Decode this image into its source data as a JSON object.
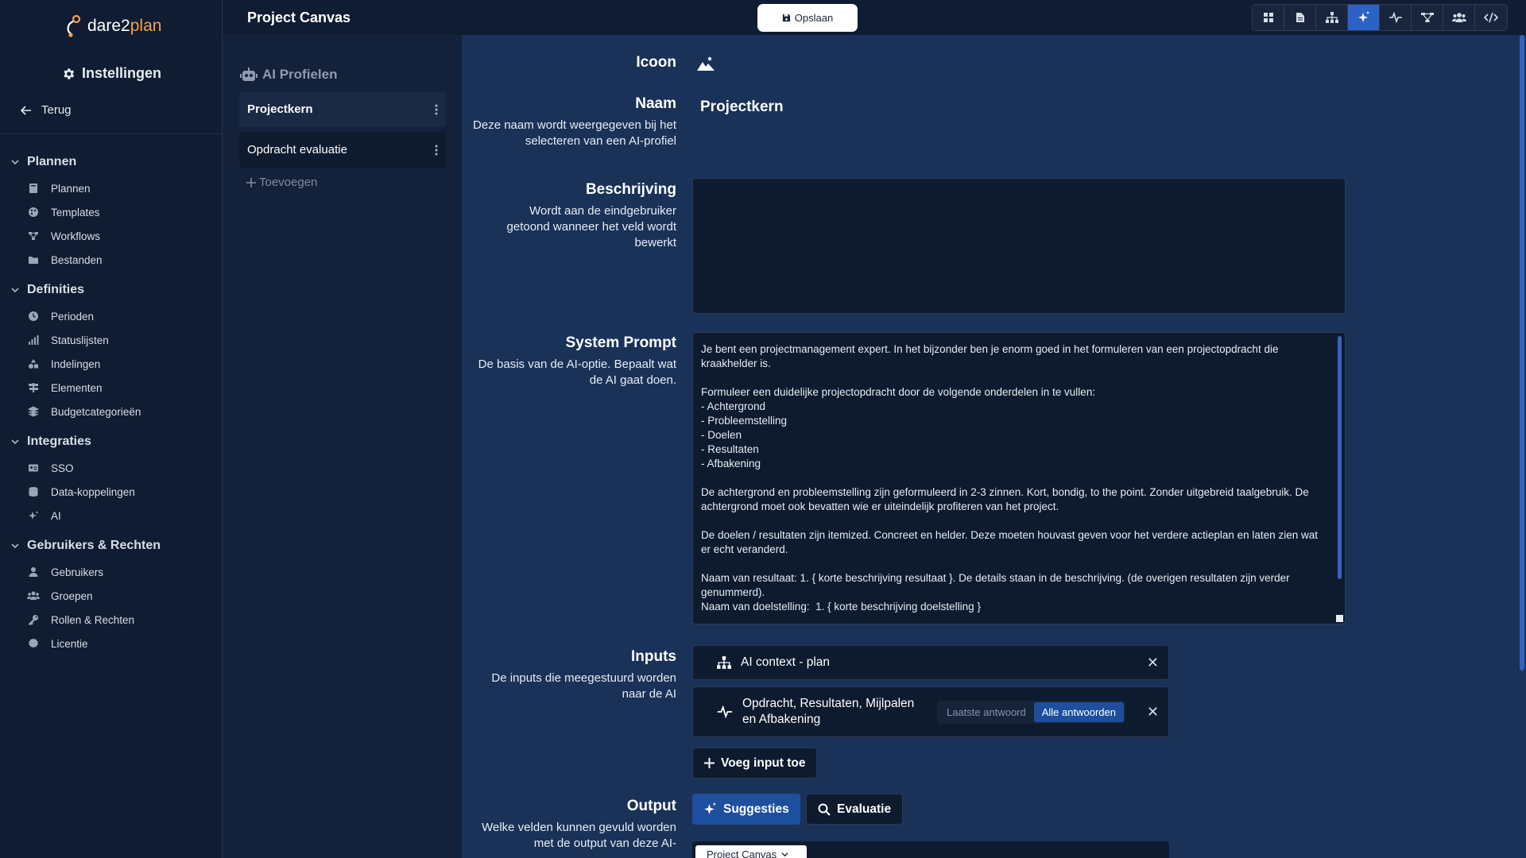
{
  "app": {
    "logo_text": "dare2",
    "logo_accent": "plan",
    "brand_color": "#f5a04a"
  },
  "sidebar": {
    "title": "Instellingen",
    "back_label": "Terug",
    "sections": [
      {
        "label": "Plannen",
        "items": [
          {
            "label": "Plannen",
            "icon": "book-icon"
          },
          {
            "label": "Templates",
            "icon": "palette-icon"
          },
          {
            "label": "Workflows",
            "icon": "workflow-icon"
          },
          {
            "label": "Bestanden",
            "icon": "folder-icon"
          }
        ]
      },
      {
        "label": "Definities",
        "items": [
          {
            "label": "Perioden",
            "icon": "clock-icon"
          },
          {
            "label": "Statuslijsten",
            "icon": "bars-icon"
          },
          {
            "label": "Indelingen",
            "icon": "shapes-icon"
          },
          {
            "label": "Elementen",
            "icon": "sign-icon"
          },
          {
            "label": "Budgetcategorieën",
            "icon": "coins-icon"
          }
        ]
      },
      {
        "label": "Integraties",
        "items": [
          {
            "label": "SSO",
            "icon": "id-card-icon"
          },
          {
            "label": "Data-koppelingen",
            "icon": "database-icon"
          },
          {
            "label": "AI",
            "icon": "sparkle-icon"
          }
        ]
      },
      {
        "label": "Gebruikers & Rechten",
        "items": [
          {
            "label": "Gebruikers",
            "icon": "user-icon"
          },
          {
            "label": "Groepen",
            "icon": "users-icon"
          },
          {
            "label": "Rollen & Rechten",
            "icon": "key-icon"
          },
          {
            "label": "Licentie",
            "icon": "certificate-icon"
          }
        ]
      }
    ]
  },
  "header": {
    "title": "Project Canvas",
    "save_label": "Opslaan",
    "toolbar": [
      "grid-icon",
      "document-icon",
      "sitemap-icon",
      "sparkle-icon",
      "pulse-icon",
      "workflow-icon",
      "users-icon",
      "code-icon"
    ],
    "active_tool": "sparkle-icon"
  },
  "profiles": {
    "title": "AI Profielen",
    "items": [
      {
        "name": "Projectkern",
        "selected": true
      },
      {
        "name": "Opdracht evaluatie",
        "selected": false
      }
    ],
    "add_label": "Toevoegen"
  },
  "form": {
    "icon": {
      "label": "Icoon",
      "value": "mountain-icon"
    },
    "name": {
      "label": "Naam",
      "description": "Deze naam wordt weergegeven bij het selecteren van een AI-profiel",
      "value": "Projectkern"
    },
    "description": {
      "label": "Beschrijving",
      "description": "Wordt aan de eindgebruiker getoond wanneer het veld wordt bewerkt",
      "value": ""
    },
    "system_prompt": {
      "label": "System Prompt",
      "description": "De basis van de AI-optie. Bepaalt wat de AI gaat doen.",
      "value": "Je bent een projectmanagement expert. In het bijzonder ben je enorm goed in het formuleren van een projectopdracht die kraakhelder is.\n\nFormuleer een duidelijke projectopdracht door de volgende onderdelen in te vullen:\n- Achtergrond\n- Probleemstelling\n- Doelen\n- Resultaten\n- Afbakening\n\nDe achtergrond en probleemstelling zijn geformuleerd in 2-3 zinnen. Kort, bondig, to the point. Zonder uitgebreid taalgebruik. De achtergrond moet ook bevatten wie er uiteindelijk profiteren van het project.\n\nDe doelen / resultaten zijn itemized. Concreet en helder. Deze moeten houvast geven voor het verdere actieplan en laten zien wat er echt veranderd.\n\nNaam van resultaat: 1. { korte beschrijving resultaat }. De details staan in de beschrijving. (de overigen resultaten zijn verder genummerd).\nNaam van doelstelling:  1. { korte beschrijving doelstelling }"
    },
    "inputs": {
      "label": "Inputs",
      "description": "De inputs die meegestuurd worden naar de AI",
      "items": [
        {
          "title": "AI context - plan",
          "icon": "sitemap-icon"
        },
        {
          "title": "Opdracht, Resultaten, Mijlpalen en Afbakening",
          "icon": "pulse-icon",
          "options": [
            "Laatste antwoord",
            "Alle antwoorden"
          ],
          "selected_option": "Alle antwoorden"
        }
      ],
      "add_label": "Voeg input toe"
    },
    "output": {
      "label": "Output",
      "description": "Welke velden kunnen gevuld worden met de output van deze AI-",
      "tabs": [
        {
          "label": "Suggesties",
          "icon": "sparkle-icon",
          "active": true
        },
        {
          "label": "Evaluatie",
          "icon": "search-icon",
          "active": false
        }
      ],
      "select_value": "Project Canvas"
    }
  }
}
